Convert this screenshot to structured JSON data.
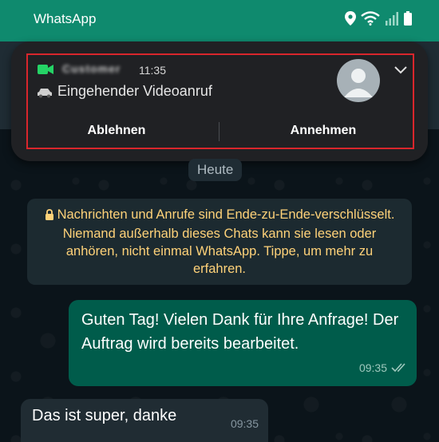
{
  "statusbar": {
    "app_name": "WhatsApp",
    "icons": [
      "location-icon",
      "wifi-icon",
      "signal-icon",
      "battery-icon"
    ]
  },
  "notification": {
    "caller_name": "Customer",
    "time": "11:35",
    "text": "Eingehender Videoanruf",
    "decline_label": "Ablehnen",
    "accept_label": "Annehmen",
    "icons": [
      "video-call-icon",
      "car-icon",
      "avatar-placeholder-icon",
      "chevron-down-icon"
    ]
  },
  "chat": {
    "day_label": "Heute",
    "encryption_notice": "Nachrichten und Anrufe sind Ende-zu-Ende-verschlüsselt. Niemand außerhalb dieses Chats kann sie lesen oder anhören, nicht einmal WhatsApp. Tippe, um mehr zu erfahren.",
    "messages": [
      {
        "direction": "outgoing",
        "text": "Guten Tag! Vielen Dank für Ihre Anfrage! Der Auftrag wird bereits bearbeitet.",
        "time": "09:35",
        "status": "read"
      },
      {
        "direction": "incoming",
        "text": "Das ist super, danke",
        "time": "09:35"
      }
    ]
  },
  "colors": {
    "statusbar": "#0f8a6e",
    "outgoing_bubble": "#005c4b",
    "incoming_bubble": "#202c33",
    "notice_text": "#ffd279",
    "highlight_frame": "#d9262c"
  }
}
